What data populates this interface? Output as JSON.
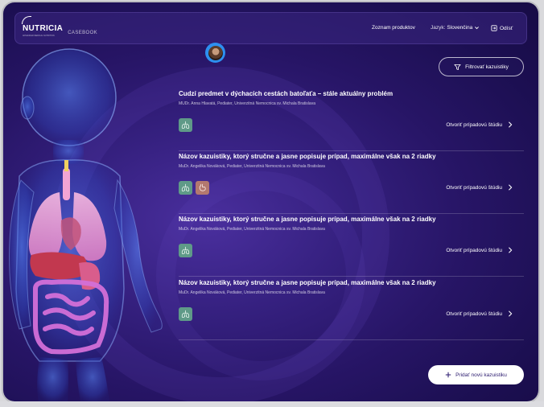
{
  "header": {
    "logo_text": "NUTRICIA",
    "logo_sub": "ADVANCED MEDICAL NUTRITION",
    "app_name": "CASEBOOK",
    "product_list_label": "Zoznam produktov",
    "language_label": "Jazyk:",
    "language_value": "Slovenčina",
    "logout_label": "Odísť"
  },
  "toolbar": {
    "filter_label": "Filtrovať kazuistiky",
    "add_label": "Pridať novú kazuistiku"
  },
  "cases": [
    {
      "title": "Cudzí predmet v dýchacích cestách batoľaťa – stále aktuálny problém",
      "author": "MUDr. Anna Hlavatá, Pediater, Univerzitná Nemocnica sv. Michala Bratislava",
      "tags": [
        "lungs-icon"
      ],
      "open_label": "Otvoriť prípadovú štúdiu"
    },
    {
      "title": "Názov kazuistiky, ktorý stručne a jasne popisuje prípad, maximálne však na 2 riadky",
      "author": "MuDr. Angelika Nováková, Pediater, Univerzitná Nemocnica sv. Michala Bratislava",
      "tags": [
        "lungs-icon",
        "stomach-icon"
      ],
      "open_label": "Otvoriť prípadovú štúdiu"
    },
    {
      "title": "Názov kazuistiky, ktorý stručne a jasne popisuje prípad, maximálne však na 2 riadky",
      "author": "MuDr. Angelika Nováková, Pediater, Univerzitná Nemocnica sv. Michala Bratislava",
      "tags": [
        "lungs-icon"
      ],
      "open_label": "Otvoriť prípadovú štúdiu"
    },
    {
      "title": "Názov kazuistiky, ktorý stručne a jasne popisuje prípad, maximálne však na 2 riadky",
      "author": "MuDr. Angelika Nováková, Pediater, Univerzitná Nemocnica sv. Michala Bratislava",
      "tags": [
        "lungs-icon"
      ],
      "open_label": "Otvoriť prípadovú štúdiu"
    }
  ],
  "colors": {
    "background": "#271566",
    "tag_lungs": "#5f9a88",
    "tag_stomach": "#b3786f",
    "avatar_ring": "#2d8ff0"
  }
}
